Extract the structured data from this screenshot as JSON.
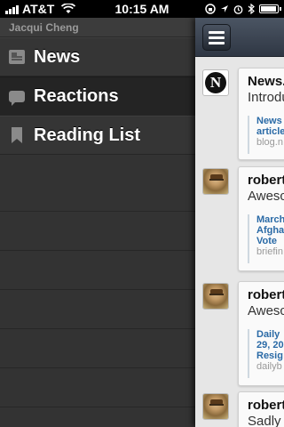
{
  "status_bar": {
    "carrier": "AT&T",
    "time": "10:15 AM",
    "signal_bars": 4,
    "battery_level": 0.85
  },
  "sidebar": {
    "account_name": "Jacqui Cheng",
    "items": [
      {
        "label": "News",
        "icon": "newspaper-icon"
      },
      {
        "label": "Reactions",
        "icon": "speech-bubble-icon"
      },
      {
        "label": "Reading List",
        "icon": "bookmark-icon"
      }
    ]
  },
  "feed": {
    "items": [
      {
        "author": "News.",
        "snippet": "Introdu",
        "link_lines": [
          "News",
          "article"
        ],
        "domain": "blog.n"
      },
      {
        "author": "robert",
        "snippet": "Awesc",
        "link_lines": [
          "March",
          "Afgha",
          "Vote"
        ],
        "domain": "briefin"
      },
      {
        "author": "robert",
        "snippet": "Awesc",
        "link_lines": [
          "Daily",
          "29, 20",
          "Resig"
        ],
        "domain": "dailyb"
      },
      {
        "author": "robert",
        "snippet": "Sadly"
      }
    ]
  }
}
